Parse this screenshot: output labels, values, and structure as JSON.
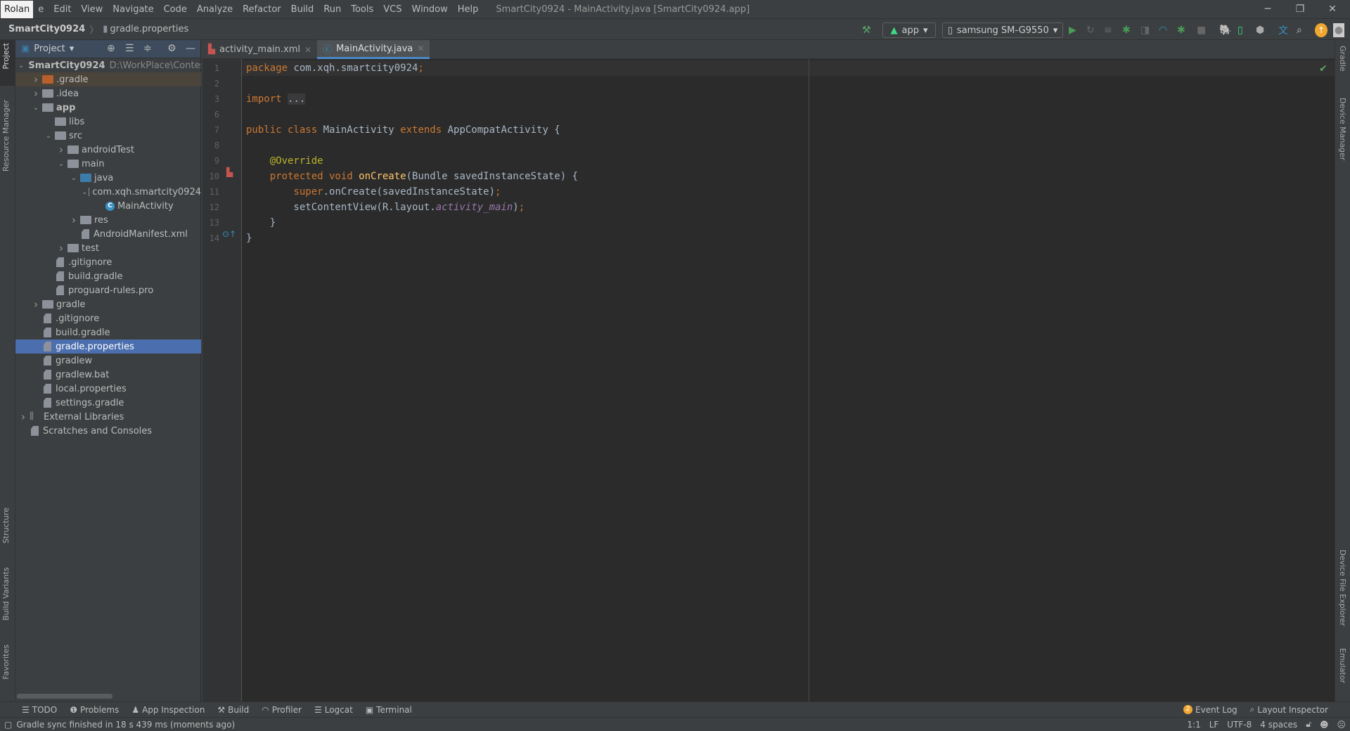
{
  "menubar": {
    "user": "Rolan",
    "items": [
      "e",
      "Edit",
      "View",
      "Navigate",
      "Code",
      "Analyze",
      "Refactor",
      "Build",
      "Run",
      "Tools",
      "VCS",
      "Window",
      "Help"
    ],
    "title": "SmartCity0924 - MainActivity.java [SmartCity0924.app]"
  },
  "breadcrumb": {
    "project": "SmartCity0924",
    "file": "gradle.properties"
  },
  "toolbar": {
    "config": "app",
    "device": "samsung SM-G9550"
  },
  "left_stripe": [
    "Project",
    "Resource Manager",
    "Structure",
    "Build Variants",
    "Favorites"
  ],
  "right_stripe": [
    "Gradle",
    "Device Manager",
    "Device File Explorer",
    "Emulator"
  ],
  "project_panel": {
    "title": "Project"
  },
  "tree": [
    {
      "label": "SmartCity0924",
      "path": "D:\\WorkPlace\\Contest",
      "level": 0,
      "arrow": "down",
      "icon": "module",
      "bold": true
    },
    {
      "label": ".gradle",
      "level": 1,
      "arrow": "right",
      "icon": "folder-orange",
      "state": "excluded"
    },
    {
      "label": ".idea",
      "level": 1,
      "arrow": "right",
      "icon": "folder"
    },
    {
      "label": "app",
      "level": 1,
      "arrow": "down",
      "icon": "module",
      "bold": true
    },
    {
      "label": "libs",
      "level": 2,
      "icon": "folder"
    },
    {
      "label": "src",
      "level": 2,
      "arrow": "down",
      "icon": "folder"
    },
    {
      "label": "androidTest",
      "level": 3,
      "arrow": "right",
      "icon": "folder"
    },
    {
      "label": "main",
      "level": 3,
      "arrow": "down",
      "icon": "folder"
    },
    {
      "label": "java",
      "level": 4,
      "arrow": "down",
      "icon": "folder-blue"
    },
    {
      "label": "com.xqh.smartcity0924",
      "level": 5,
      "arrow": "down",
      "icon": "package"
    },
    {
      "label": "MainActivity",
      "level": 6,
      "icon": "class"
    },
    {
      "label": "res",
      "level": 4,
      "arrow": "right",
      "icon": "folder"
    },
    {
      "label": "AndroidManifest.xml",
      "level": 4,
      "icon": "file"
    },
    {
      "label": "test",
      "level": 3,
      "arrow": "right",
      "icon": "folder"
    },
    {
      "label": ".gitignore",
      "level": 2,
      "icon": "file"
    },
    {
      "label": "build.gradle",
      "level": 2,
      "icon": "file"
    },
    {
      "label": "proguard-rules.pro",
      "level": 2,
      "icon": "file"
    },
    {
      "label": "gradle",
      "level": 1,
      "arrow": "right",
      "icon": "folder"
    },
    {
      "label": ".gitignore",
      "level": 1,
      "icon": "file"
    },
    {
      "label": "build.gradle",
      "level": 1,
      "icon": "file"
    },
    {
      "label": "gradle.properties",
      "level": 1,
      "icon": "file",
      "state": "selected"
    },
    {
      "label": "gradlew",
      "level": 1,
      "icon": "file"
    },
    {
      "label": "gradlew.bat",
      "level": 1,
      "icon": "file"
    },
    {
      "label": "local.properties",
      "level": 1,
      "icon": "file"
    },
    {
      "label": "settings.gradle",
      "level": 1,
      "icon": "file"
    },
    {
      "label": "External Libraries",
      "level": 0,
      "arrow": "right",
      "icon": "libs"
    },
    {
      "label": "Scratches and Consoles",
      "level": 0,
      "icon": "file"
    }
  ],
  "tabs": [
    {
      "label": "activity_main.xml",
      "active": false
    },
    {
      "label": "MainActivity.java",
      "active": true
    }
  ],
  "code": [
    {
      "n": "1",
      "t": [
        [
          "kw",
          "package "
        ],
        [
          "",
          "com.xqh.smartcity0924"
        ],
        [
          "kw",
          ";"
        ]
      ]
    },
    {
      "n": "2",
      "t": []
    },
    {
      "n": "3",
      "t": [
        [
          "kw",
          "import "
        ],
        [
          "fold",
          "..."
        ]
      ]
    },
    {
      "n": "6",
      "t": []
    },
    {
      "n": "7",
      "t": [
        [
          "kw",
          "public class "
        ],
        [
          "",
          "MainActivity "
        ],
        [
          "kw",
          "extends "
        ],
        [
          "",
          "AppCompatActivity {"
        ]
      ]
    },
    {
      "n": "8",
      "t": []
    },
    {
      "n": "9",
      "t": [
        [
          "",
          "    "
        ],
        [
          "an",
          "@Override"
        ]
      ]
    },
    {
      "n": "10",
      "t": [
        [
          "",
          "    "
        ],
        [
          "kw",
          "protected void "
        ],
        [
          "fn",
          "onCreate"
        ],
        [
          "",
          "(Bundle savedInstanceState) {"
        ]
      ]
    },
    {
      "n": "11",
      "t": [
        [
          "",
          "        "
        ],
        [
          "kw",
          "super"
        ],
        [
          "",
          ".onCreate(savedInstanceState)"
        ],
        [
          "kw",
          ";"
        ]
      ]
    },
    {
      "n": "12",
      "t": [
        [
          "",
          "        setContentView(R.layout."
        ],
        [
          "it",
          "activity_main"
        ],
        [
          "",
          ")"
        ],
        [
          "kw",
          ";"
        ]
      ]
    },
    {
      "n": "13",
      "t": [
        [
          "",
          "    }"
        ]
      ]
    },
    {
      "n": "14",
      "t": [
        [
          "",
          "}"
        ]
      ]
    }
  ],
  "bottom_tools": {
    "left": [
      "TODO",
      "Problems",
      "App Inspection",
      "Build",
      "Profiler",
      "Logcat",
      "Terminal"
    ],
    "right": [
      "Event Log",
      "Layout Inspector"
    ],
    "event_count": "2"
  },
  "status": {
    "message": "Gradle sync finished in 18 s 439 ms (moments ago)",
    "position": "1:1",
    "line_sep": "LF",
    "encoding": "UTF-8",
    "indent": "4 spaces"
  },
  "colors": {
    "keyword": "#cc7832",
    "annotation": "#bbb529",
    "method": "#ffc66d",
    "field": "#9876aa",
    "selection": "#4b6eaf",
    "accent": "#4a88c7"
  }
}
